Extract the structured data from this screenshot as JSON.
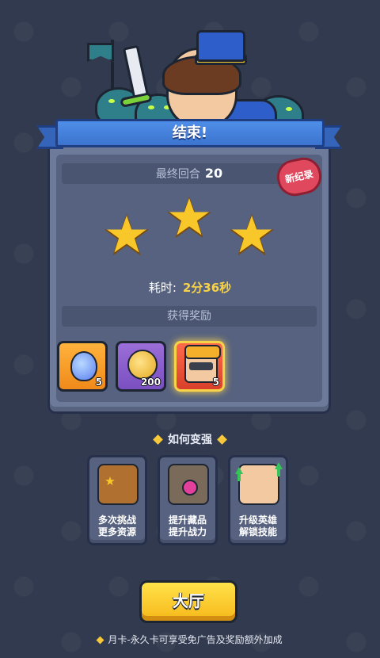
{
  "result": {
    "title": "结束!",
    "badge": "新纪录",
    "final_round_label": "最终回合",
    "final_round_value": "20",
    "stars_earned": 3,
    "stars_total": 3,
    "time_label": "耗时:",
    "time_value": "2分36秒",
    "rewards_header": "获得奖励",
    "rewards": [
      {
        "icon": "gem-icon",
        "qty": "5",
        "color": "#f08a1a"
      },
      {
        "icon": "coin-icon",
        "qty": "200",
        "color": "#7a4fc0"
      },
      {
        "icon": "hero-icon",
        "qty": "5",
        "color": "#d8402a"
      }
    ]
  },
  "tips": {
    "header": "如何变强",
    "items": [
      {
        "icon": "chest-icon",
        "line1": "多次挑战",
        "line2": "更多资源"
      },
      {
        "icon": "glove-icon",
        "line1": "提升藏品",
        "line2": "提升战力"
      },
      {
        "icon": "hero-upgrade-icon",
        "line1": "升级英雄",
        "line2": "解锁技能"
      }
    ]
  },
  "lobby_button": "大厅",
  "footer_text": "月卡-永久卡可享受免广告及奖励额外加成"
}
